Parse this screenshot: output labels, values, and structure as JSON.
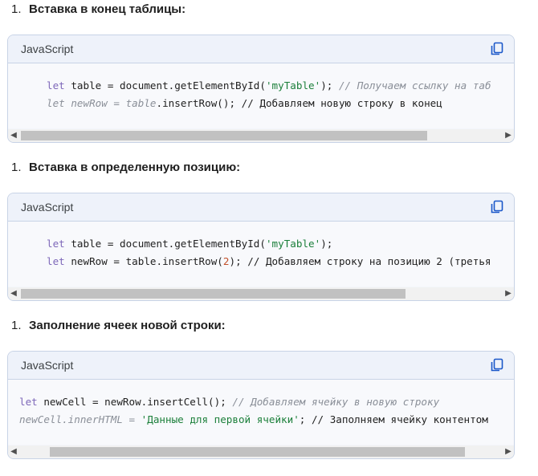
{
  "sections": [
    {
      "number": "1.",
      "heading": "Вставка в конец таблицы:",
      "language": "JavaScript",
      "copy_icon": "copy-icon",
      "lines": [
        [
          {
            "t": "let",
            "c": "kw"
          },
          {
            "t": " table = document.getElementById(",
            "c": ""
          },
          {
            "t": "'myTable'",
            "c": "str"
          },
          {
            "t": "); ",
            "c": ""
          },
          {
            "t": "// Получаем ссылку на таб",
            "c": "cmt"
          }
        ],
        [
          {
            "t": "let newRow = table",
            "c": "it"
          },
          {
            "t": ".insertRow(); // Добавляем новую строку в конец",
            "c": ""
          }
        ]
      ]
    },
    {
      "number": "1.",
      "heading": "Вставка в определенную позицию:",
      "language": "JavaScript",
      "copy_icon": "copy-icon",
      "lines": [
        [
          {
            "t": "let",
            "c": "kw"
          },
          {
            "t": " table = document.getElementById(",
            "c": ""
          },
          {
            "t": "'myTable'",
            "c": "str"
          },
          {
            "t": ");",
            "c": ""
          }
        ],
        [
          {
            "t": "let",
            "c": "kw"
          },
          {
            "t": " newRow = table.insertRow(",
            "c": ""
          },
          {
            "t": "2",
            "c": "num2"
          },
          {
            "t": "); // Добавляем строку на позицию 2 (третья",
            "c": ""
          }
        ]
      ]
    },
    {
      "number": "1.",
      "heading": "Заполнение ячеек новой строки:",
      "language": "JavaScript",
      "copy_icon": "copy-icon",
      "lines": [
        [
          {
            "t": "let",
            "c": "kw"
          },
          {
            "t": " newCell = newRow.insertCell(); ",
            "c": ""
          },
          {
            "t": "// Добавляем ячейку в новую строку",
            "c": "cmt"
          }
        ],
        [
          {
            "t": "newCell.innerHTML = ",
            "c": "it"
          },
          {
            "t": "'Данные для первой ячейки'",
            "c": "str"
          },
          {
            "t": "; // Заполняем ячейку контентом",
            "c": ""
          }
        ]
      ]
    }
  ],
  "scrollbars": [
    {
      "thumb_start": 0.0,
      "thumb_fraction": 0.92
    },
    {
      "thumb_start": 0.0,
      "thumb_fraction": 0.87
    },
    {
      "thumb_start": 0.06,
      "thumb_fraction": 0.94
    }
  ],
  "colors": {
    "keyword": "#7e68b9",
    "string": "#1b7f3a",
    "number": "#c2512b",
    "comment": "#8a8f98",
    "copy_icon": "#1a57c9"
  }
}
